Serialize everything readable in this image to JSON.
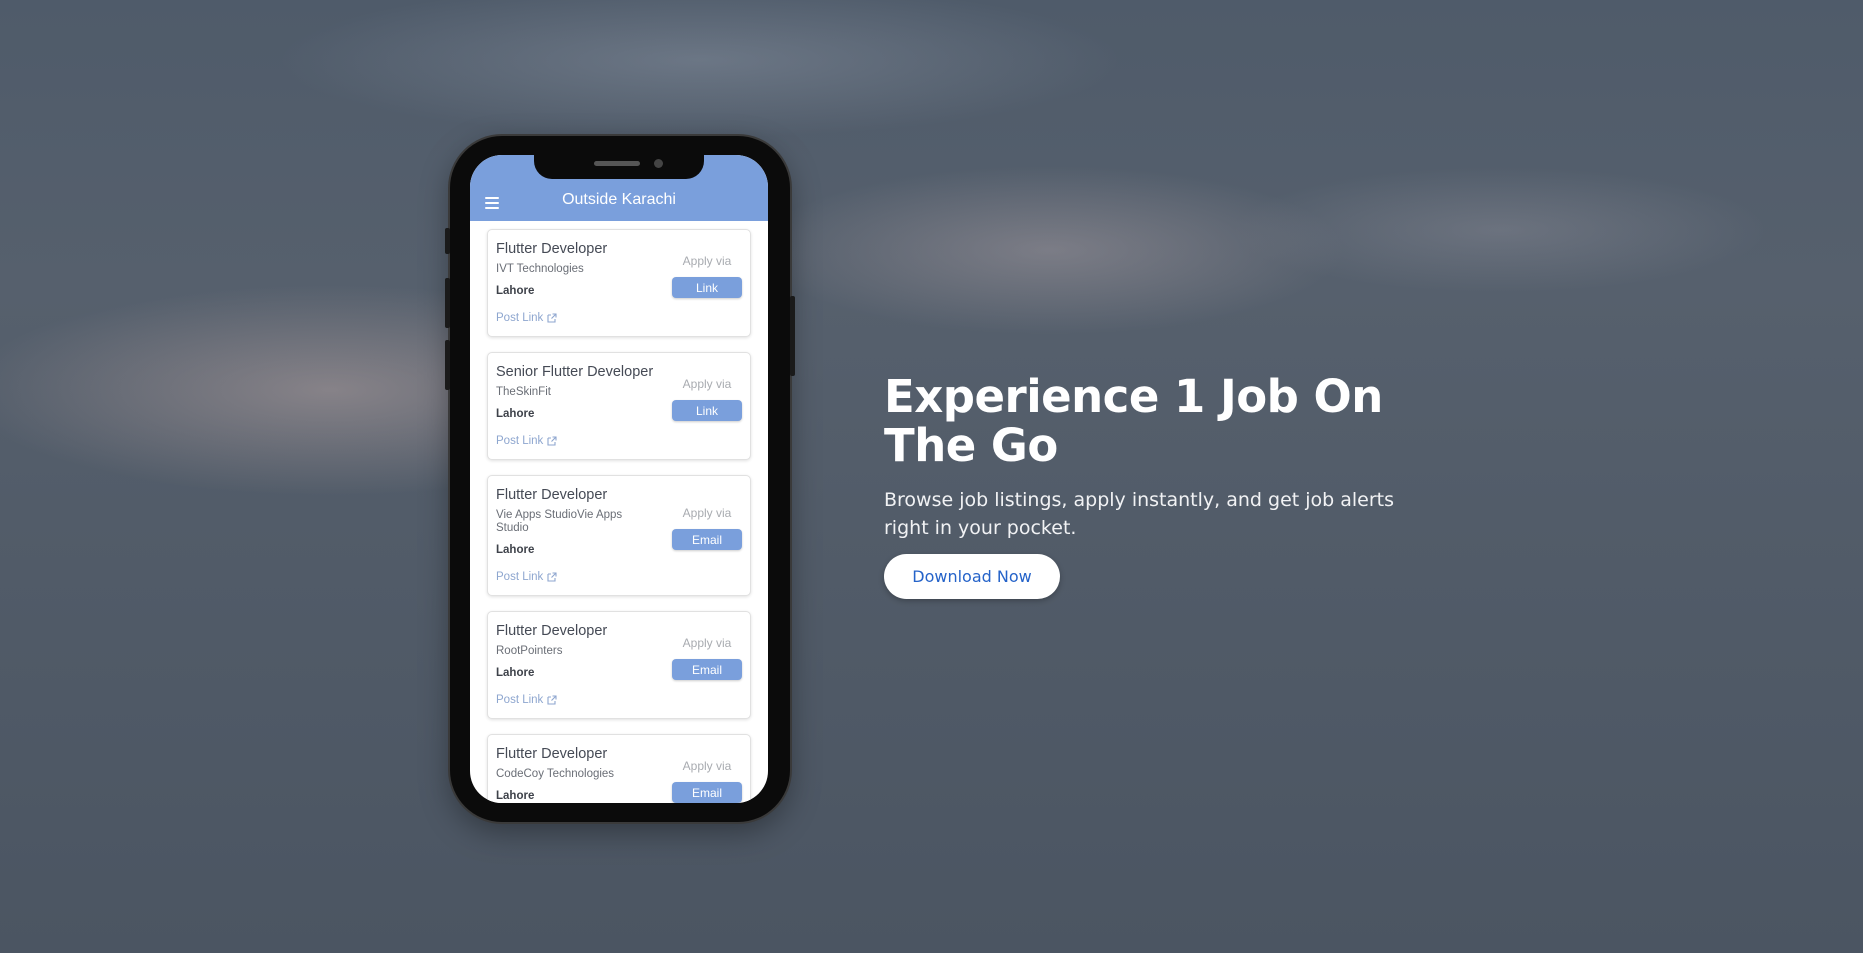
{
  "app": {
    "title": "Outside Karachi",
    "apply_via_label": "Apply via",
    "post_link_label": "Post Link"
  },
  "jobs": [
    {
      "title": "Flutter Developer",
      "company": "IVT Technologies",
      "location": "Lahore",
      "apply_method": "Link"
    },
    {
      "title": "Senior Flutter Developer",
      "company": "TheSkinFit",
      "location": "Lahore",
      "apply_method": "Link"
    },
    {
      "title": "Flutter Developer",
      "company": "Vie Apps StudioVie Apps Studio",
      "location": "Lahore",
      "apply_method": "Email"
    },
    {
      "title": "Flutter Developer",
      "company": "RootPointers",
      "location": "Lahore",
      "apply_method": "Email"
    },
    {
      "title": "Flutter Developer",
      "company": "CodeCoy Technologies",
      "location": "Lahore",
      "apply_method": "Email"
    }
  ],
  "hero": {
    "heading": "Experience 1 Job On The Go",
    "subheading": "Browse job listings, apply instantly, and get job alerts right in your pocket.",
    "cta_label": "Download Now"
  },
  "colors": {
    "app_accent": "#7a9fdc",
    "cta_text": "#2563c9",
    "post_link": "#8ea6cf"
  },
  "icons": {
    "menu": "menu-icon",
    "external_link": "external-link-icon"
  }
}
